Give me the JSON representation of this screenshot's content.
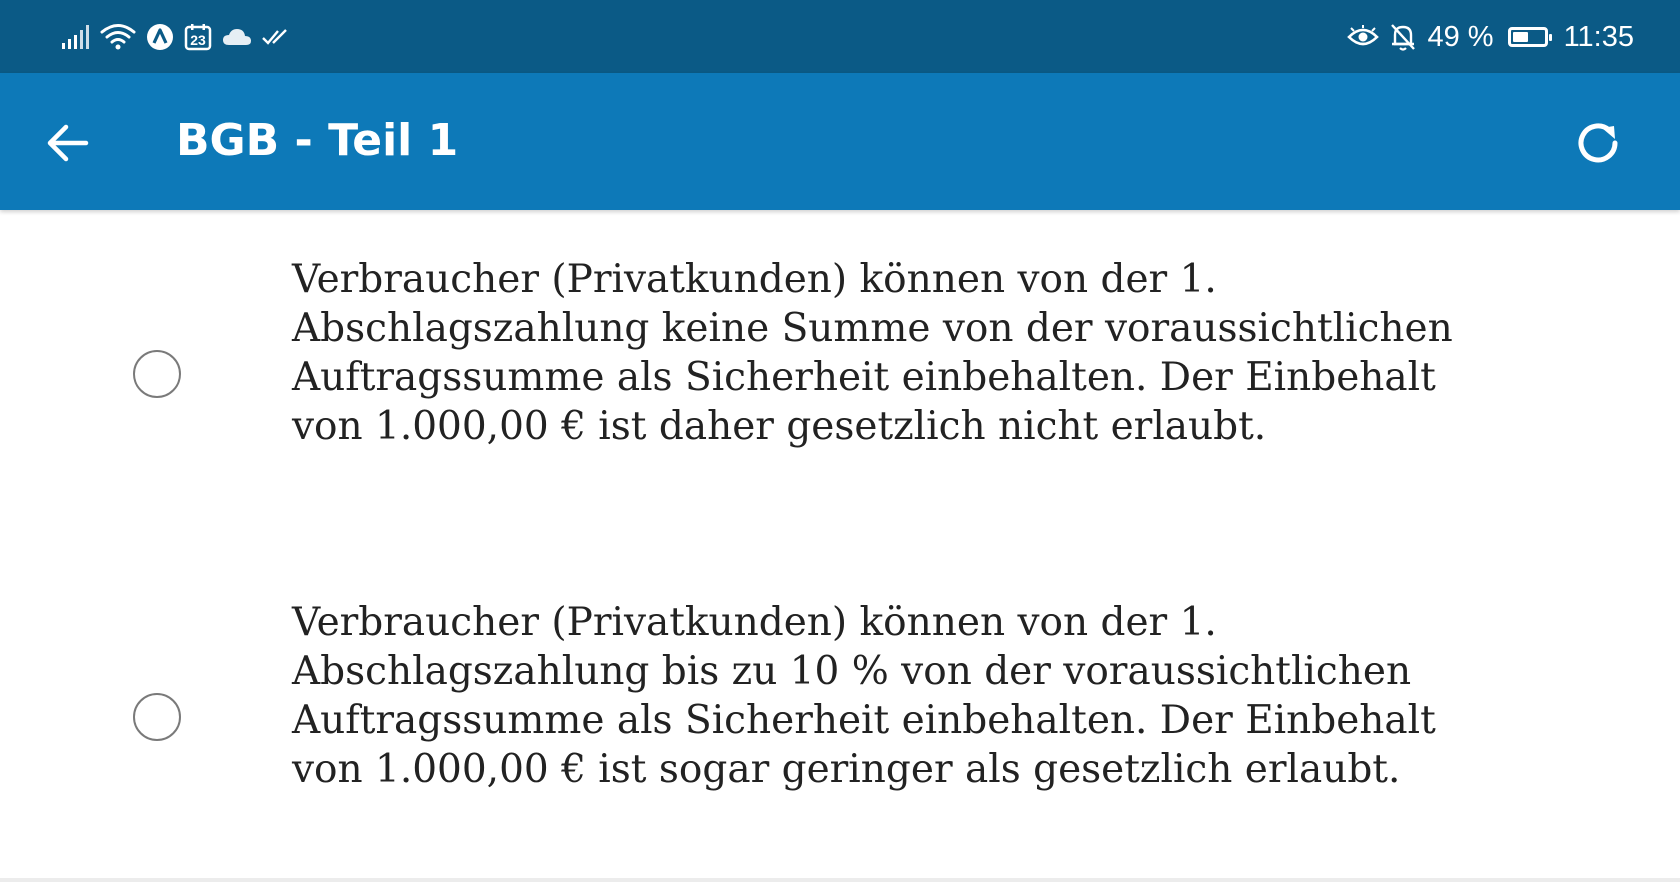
{
  "status_bar": {
    "battery_percent_text": "49 %",
    "battery_level": 0.49,
    "time": "11:35",
    "calendar_day": "23",
    "left_icons": [
      "signal-icon",
      "wifi-icon",
      "app-a-icon",
      "calendar-icon",
      "cloud-icon",
      "double-check-icon"
    ],
    "right_icons": [
      "eye-icon",
      "bell-off-icon",
      "battery-icon"
    ]
  },
  "app_bar": {
    "title": "BGB - Teil 1",
    "background": "#0d79b8",
    "status_background": "#0b5a86"
  },
  "answers": [
    {
      "text": "Verbraucher (Privatkunden) können von der 1. Abschlagszahlung keine Summe von der voraussichtlichen Auftragssumme als Sicherheit einbehalten. Der Einbehalt von 1.000,00 € ist daher gesetzlich nicht erlaubt.",
      "selected": false
    },
    {
      "text": "Verbraucher (Privatkunden) können von der 1. Abschlagszahlung bis zu 10 % von der voraussichtlichen Auftragssumme als Sicherheit einbehalten. Der Einbehalt von 1.000,00 € ist sogar geringer als gesetzlich erlaubt.",
      "selected": false
    }
  ]
}
